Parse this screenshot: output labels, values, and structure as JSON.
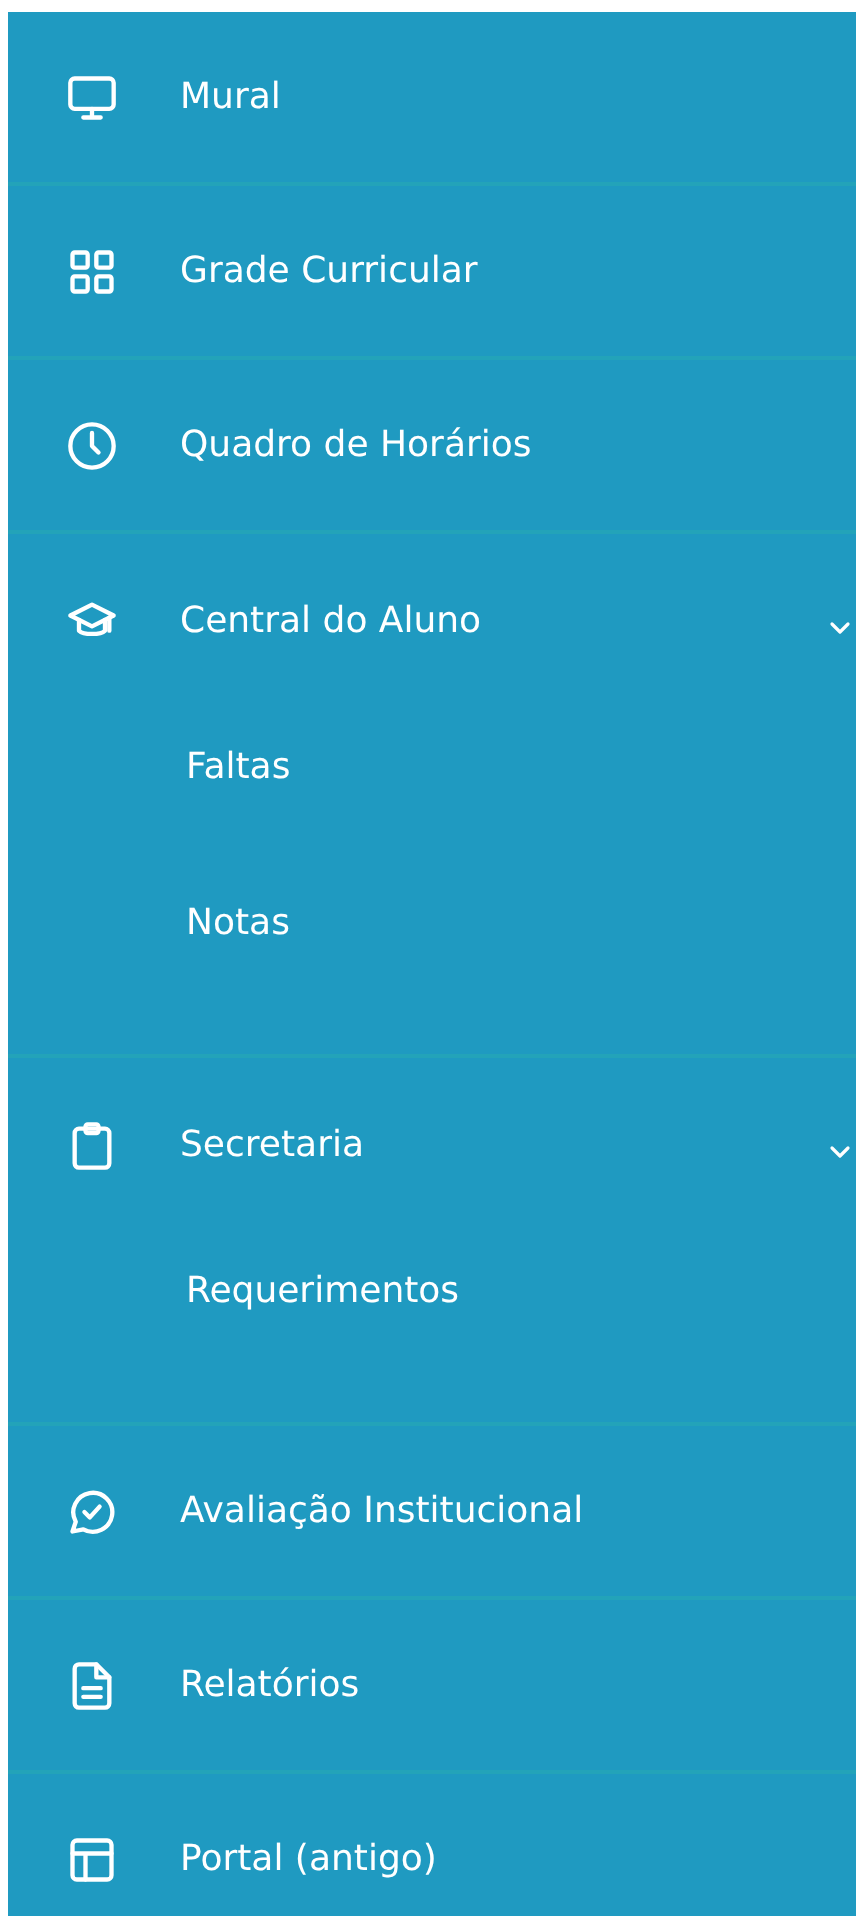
{
  "sidebar": {
    "items": [
      {
        "kind": "link",
        "label": "Mural"
      },
      {
        "kind": "link",
        "label": "Grade Curricular"
      },
      {
        "kind": "link",
        "label": "Quadro de Horários"
      },
      {
        "kind": "group",
        "label": "Central do Aluno",
        "expanded": true,
        "children": [
          {
            "label": "Faltas"
          },
          {
            "label": "Notas"
          }
        ]
      },
      {
        "kind": "group",
        "label": "Secretaria",
        "expanded": true,
        "children": [
          {
            "label": "Requerimentos"
          }
        ]
      },
      {
        "kind": "link",
        "label": "Avaliação Institucional"
      },
      {
        "kind": "link",
        "label": "Relatórios"
      },
      {
        "kind": "link",
        "label": "Portal (antigo)"
      }
    ]
  }
}
